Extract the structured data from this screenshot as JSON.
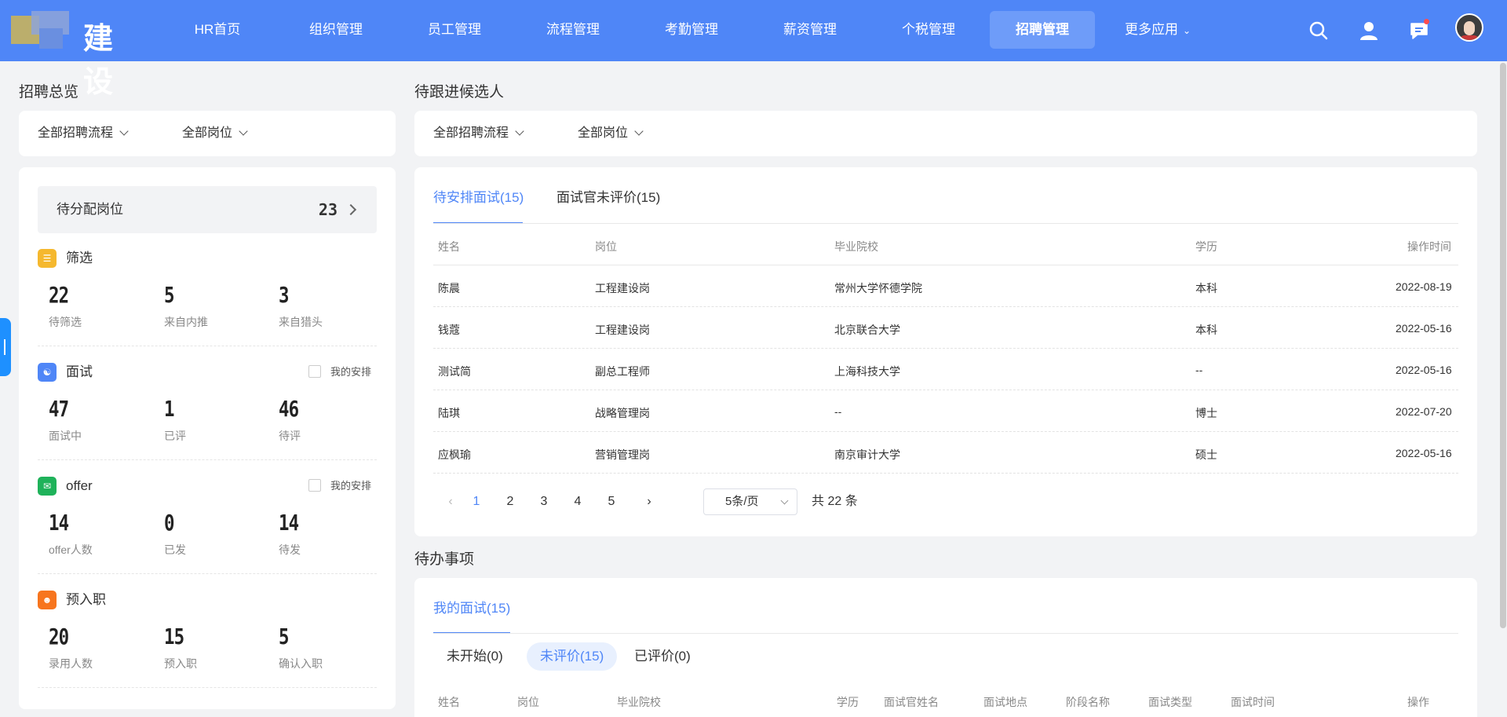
{
  "app": {
    "logo_text": "建设",
    "nav": [
      {
        "label": "HR首页"
      },
      {
        "label": "组织管理"
      },
      {
        "label": "员工管理"
      },
      {
        "label": "流程管理"
      },
      {
        "label": "考勤管理"
      },
      {
        "label": "薪资管理"
      },
      {
        "label": "个税管理"
      },
      {
        "label": "招聘管理"
      },
      {
        "label": "更多应用"
      }
    ],
    "active_nav": "招聘管理"
  },
  "overview": {
    "title": "招聘总览",
    "filters": [
      "全部招聘流程",
      "全部岗位"
    ],
    "pending": {
      "label": "待分配岗位",
      "count": "23"
    },
    "groups": [
      {
        "name": "筛选",
        "icon": "filter-icon",
        "color": "#f5b82e",
        "my_arrange": "",
        "stats": [
          {
            "value": "22",
            "label": "待筛选"
          },
          {
            "value": "5",
            "label": "来自内推"
          },
          {
            "value": "3",
            "label": "来自猎头"
          }
        ]
      },
      {
        "name": "面试",
        "icon": "interview-icon",
        "color": "#4f86f7",
        "my_arrange": "我的安排",
        "stats": [
          {
            "value": "47",
            "label": "面试中"
          },
          {
            "value": "1",
            "label": "已评"
          },
          {
            "value": "46",
            "label": "待评"
          }
        ]
      },
      {
        "name": "offer",
        "icon": "mail-icon",
        "color": "#1fb25a",
        "my_arrange": "我的安排",
        "stats": [
          {
            "value": "14",
            "label": "offer人数"
          },
          {
            "value": "0",
            "label": "已发"
          },
          {
            "value": "14",
            "label": "待发"
          }
        ]
      },
      {
        "name": "预入职",
        "icon": "person-icon",
        "color": "#f7751e",
        "my_arrange": "",
        "stats": [
          {
            "value": "20",
            "label": "录用人数"
          },
          {
            "value": "15",
            "label": "预入职"
          },
          {
            "value": "5",
            "label": "确认入职"
          }
        ]
      }
    ]
  },
  "candidates": {
    "title": "待跟进候选人",
    "filters": [
      "全部招聘流程",
      "全部岗位"
    ],
    "tabs": [
      {
        "label": "待安排面试",
        "count": "(15)"
      },
      {
        "label": "面试官未评价",
        "count": "(15)"
      }
    ],
    "columns": [
      "姓名",
      "岗位",
      "毕业院校",
      "学历",
      "操作时间"
    ],
    "rows": [
      [
        "陈晨",
        "工程建设岗",
        "常州大学怀德学院",
        "本科",
        "2022-08-19"
      ],
      [
        "钱蔻",
        "工程建设岗",
        "北京联合大学",
        "本科",
        "2022-05-16"
      ],
      [
        "测试简",
        "副总工程师",
        "上海科技大学",
        "--",
        "2022-05-16"
      ],
      [
        "陆琪",
        "战略管理岗",
        "--",
        "博士",
        "2022-07-20"
      ],
      [
        "应枫瑜",
        "营销管理岗",
        "南京审计大学",
        "硕士",
        "2022-05-16"
      ]
    ],
    "pager": {
      "pages": [
        "1",
        "2",
        "3",
        "4",
        "5"
      ],
      "current": "1",
      "page_size": "5条/页",
      "total": "共 22 条"
    }
  },
  "todo": {
    "title": "待办事项",
    "tab": {
      "label": "我的面试",
      "count": "(15)"
    },
    "subtabs": [
      "未开始(0)",
      "未评价(15)",
      "已评价(0)"
    ],
    "active_subtab": "未评价(15)",
    "columns": [
      "姓名",
      "岗位",
      "毕业院校",
      "学历",
      "面试官姓名",
      "面试地点",
      "阶段名称",
      "面试类型",
      "面试时间",
      "操作"
    ]
  },
  "colors": {
    "primary": "#4f86f7",
    "nav_bg": "#4f86f7",
    "page_bg": "#f2f3f5"
  }
}
